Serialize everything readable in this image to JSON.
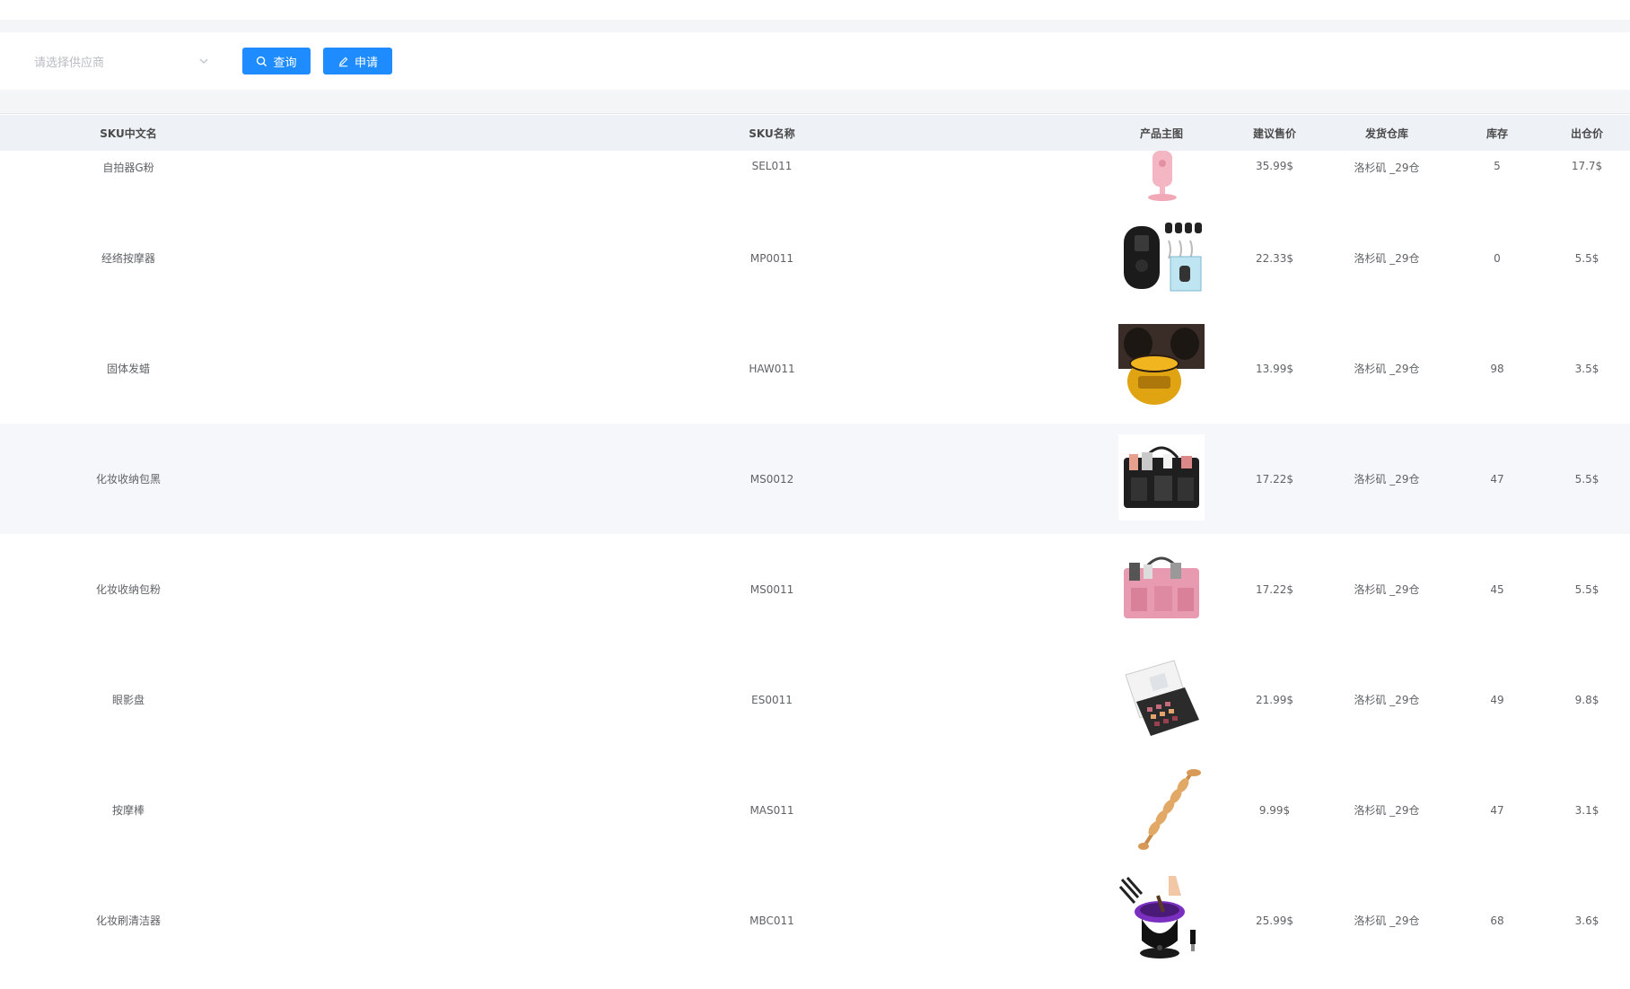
{
  "toolbar": {
    "supplier_placeholder": "请选择供应商",
    "query_label": "查询",
    "apply_label": "申请"
  },
  "columns": [
    "SKU中文名",
    "SKU名称",
    "产品主图",
    "建议售价",
    "发货仓库",
    "库存",
    "出仓价"
  ],
  "rows": [
    {
      "cn": "自拍器G粉",
      "sku": "SEL011",
      "price": "35.99$",
      "warehouse": "洛杉矶 _29仓",
      "stock": "5",
      "out": "17.7$",
      "image": "pink-selfie-stick"
    },
    {
      "cn": "经络按摩器",
      "sku": "MP0011",
      "price": "22.33$",
      "warehouse": "洛杉矶 _29仓",
      "stock": "0",
      "out": "5.5$",
      "image": "black-massager-kit"
    },
    {
      "cn": "固体发蜡",
      "sku": "HAW011",
      "price": "13.99$",
      "warehouse": "洛杉矶 _29仓",
      "stock": "98",
      "out": "3.5$",
      "image": "hair-gel-jar"
    },
    {
      "cn": "化妆收纳包黑",
      "sku": "MS0012",
      "price": "17.22$",
      "warehouse": "洛杉矶 _29仓",
      "stock": "47",
      "out": "5.5$",
      "image": "black-organizer-bag"
    },
    {
      "cn": "化妆收纳包粉",
      "sku": "MS0011",
      "price": "17.22$",
      "warehouse": "洛杉矶 _29仓",
      "stock": "45",
      "out": "5.5$",
      "image": "pink-organizer-bag"
    },
    {
      "cn": "眼影盘",
      "sku": "ES0011",
      "price": "21.99$",
      "warehouse": "洛杉矶 _29仓",
      "stock": "49",
      "out": "9.8$",
      "image": "eyeshadow-palette"
    },
    {
      "cn": "按摩棒",
      "sku": "MAS011",
      "price": "9.99$",
      "warehouse": "洛杉矶 _29仓",
      "stock": "47",
      "out": "3.1$",
      "image": "wooden-massage-roller"
    },
    {
      "cn": "化妆刷清洁器",
      "sku": "MBC011",
      "price": "25.99$",
      "warehouse": "洛杉矶 _29仓",
      "stock": "68",
      "out": "3.6$",
      "image": "brush-cleaner"
    }
  ]
}
